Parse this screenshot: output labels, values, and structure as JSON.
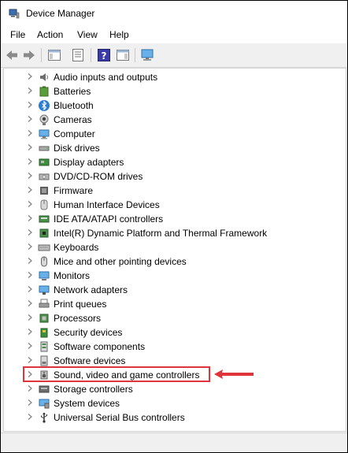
{
  "window": {
    "title": "Device Manager"
  },
  "menu": [
    "File",
    "Action",
    "View",
    "Help"
  ],
  "toolbar": {
    "buttons": [
      "back-icon",
      "forward-icon",
      "show-hide-console-tree-icon",
      "properties-icon",
      "help-icon",
      "action-pane-icon",
      "scan-hardware-icon"
    ]
  },
  "tree": {
    "items": [
      {
        "label": "Audio inputs and outputs",
        "icon": "speaker-icon"
      },
      {
        "label": "Batteries",
        "icon": "battery-icon"
      },
      {
        "label": "Bluetooth",
        "icon": "bluetooth-icon"
      },
      {
        "label": "Cameras",
        "icon": "camera-icon"
      },
      {
        "label": "Computer",
        "icon": "computer-icon"
      },
      {
        "label": "Disk drives",
        "icon": "disk-drive-icon"
      },
      {
        "label": "Display adapters",
        "icon": "display-adapter-icon"
      },
      {
        "label": "DVD/CD-ROM drives",
        "icon": "dvd-drive-icon"
      },
      {
        "label": "Firmware",
        "icon": "firmware-icon"
      },
      {
        "label": "Human Interface Devices",
        "icon": "hid-icon"
      },
      {
        "label": "IDE ATA/ATAPI controllers",
        "icon": "ide-controller-icon"
      },
      {
        "label": "Intel(R) Dynamic Platform and Thermal Framework",
        "icon": "thermal-framework-icon"
      },
      {
        "label": "Keyboards",
        "icon": "keyboard-icon"
      },
      {
        "label": "Mice and other pointing devices",
        "icon": "mouse-icon"
      },
      {
        "label": "Monitors",
        "icon": "monitor-icon"
      },
      {
        "label": "Network adapters",
        "icon": "network-adapter-icon"
      },
      {
        "label": "Print queues",
        "icon": "printer-icon"
      },
      {
        "label": "Processors",
        "icon": "processor-icon"
      },
      {
        "label": "Security devices",
        "icon": "security-device-icon"
      },
      {
        "label": "Software components",
        "icon": "software-component-icon"
      },
      {
        "label": "Software devices",
        "icon": "software-device-icon"
      },
      {
        "label": "Sound, video and game controllers",
        "icon": "sound-controller-icon",
        "highlighted": true
      },
      {
        "label": "Storage controllers",
        "icon": "storage-controller-icon"
      },
      {
        "label": "System devices",
        "icon": "system-device-icon"
      },
      {
        "label": "Universal Serial Bus controllers",
        "icon": "usb-controller-icon"
      }
    ]
  },
  "colors": {
    "highlight": "#e0343a",
    "accent": "#2b7cd3"
  }
}
